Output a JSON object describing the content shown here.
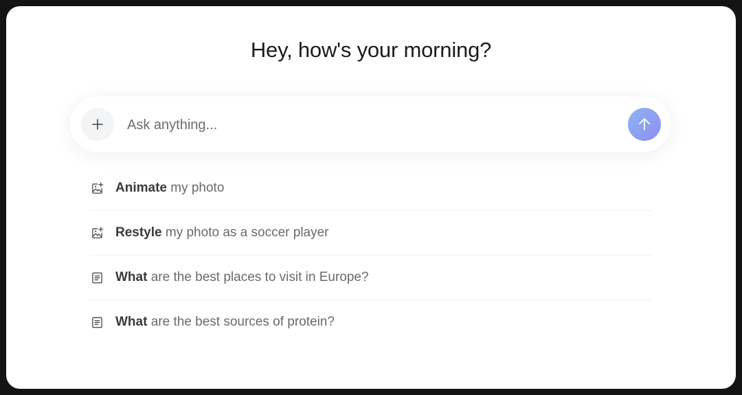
{
  "heading": "Hey, how's your morning?",
  "composer": {
    "placeholder": "Ask anything...",
    "plus_icon": "plus-icon",
    "send_icon": "arrow-up-icon",
    "send_color_start": "#8fb4f3",
    "send_color_end": "#8d8ef0"
  },
  "suggestions": [
    {
      "icon": "image-sparkle-icon",
      "lead": "Animate",
      "rest": " my photo"
    },
    {
      "icon": "image-sparkle-icon",
      "lead": "Restyle",
      "rest": " my photo as a soccer player"
    },
    {
      "icon": "document-icon",
      "lead": "What",
      "rest": " are the best places to visit in Europe?"
    },
    {
      "icon": "document-icon",
      "lead": "What",
      "rest": " are the best sources of protein?"
    }
  ]
}
